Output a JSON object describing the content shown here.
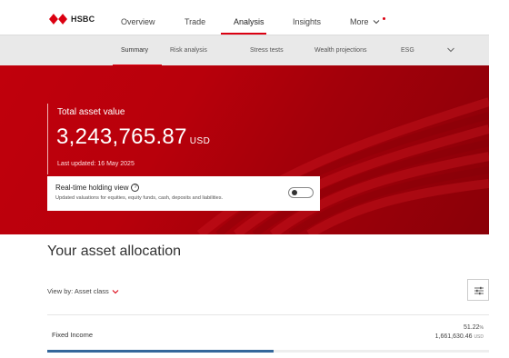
{
  "brand": {
    "name": "HSBC",
    "accent": "#db0011"
  },
  "topnav": {
    "items": [
      "Overview",
      "Trade",
      "Analysis",
      "Insights",
      "More"
    ],
    "active": "Analysis"
  },
  "subnav": {
    "items": [
      "Summary",
      "Risk analysis",
      "Stress tests",
      "Wealth projections",
      "ESG"
    ],
    "active": "Summary"
  },
  "hero": {
    "label": "Total asset value",
    "value": "3,243,765.87",
    "currency": "USD",
    "updated": "Last updated: 16 May 2025",
    "realtime": {
      "title": "Real-time holding view",
      "help": "?",
      "description": "Updated valuations for equities, equity funds, cash, deposits and liabilities.",
      "enabled": false
    }
  },
  "allocation": {
    "title": "Your asset allocation",
    "view_by_label": "View by: Asset class",
    "rows": [
      {
        "label": "Fixed Income",
        "percent": "51.22",
        "percent_unit": "%",
        "amount": "1,661,630.46",
        "currency": "USD",
        "share": 0.5122
      }
    ]
  }
}
